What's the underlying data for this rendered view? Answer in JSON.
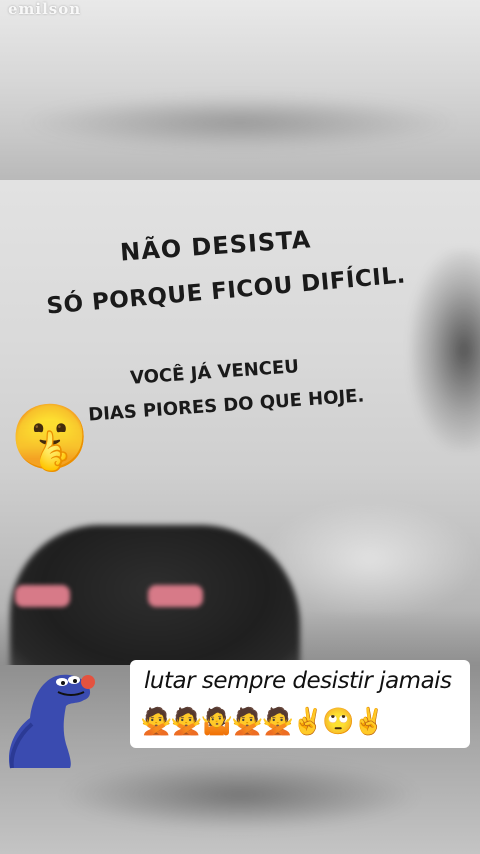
{
  "watermark": "emilson",
  "quote": {
    "line1": "NÃO DESISTA",
    "line2": "SÓ PORQUE FICOU DIFÍCIL.",
    "line3": "VOCÊ JÁ VENCEU",
    "line4": "DIAS PIORES DO QUE HOJE."
  },
  "sticker_emoji": "🤫",
  "caption": {
    "text": "lutar sempre desistir jamais",
    "emojis": "🙅🙅🤷🙅🙅✌️🙄✌️"
  },
  "colors": {
    "text": "#1a1a1a",
    "taillight": "#d77a88",
    "monster": "#3a4bb0"
  }
}
